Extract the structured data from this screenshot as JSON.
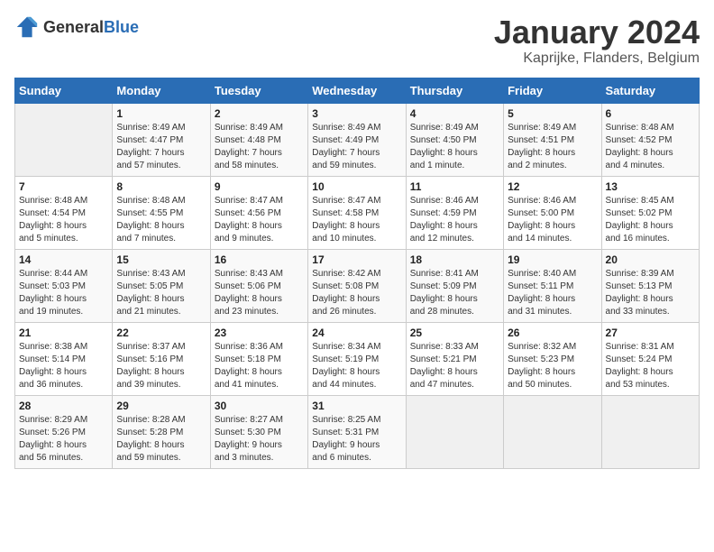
{
  "logo": {
    "general": "General",
    "blue": "Blue"
  },
  "title": "January 2024",
  "location": "Kaprijke, Flanders, Belgium",
  "days_header": [
    "Sunday",
    "Monday",
    "Tuesday",
    "Wednesday",
    "Thursday",
    "Friday",
    "Saturday"
  ],
  "weeks": [
    [
      {
        "day": "",
        "content": ""
      },
      {
        "day": "1",
        "content": "Sunrise: 8:49 AM\nSunset: 4:47 PM\nDaylight: 7 hours\nand 57 minutes."
      },
      {
        "day": "2",
        "content": "Sunrise: 8:49 AM\nSunset: 4:48 PM\nDaylight: 7 hours\nand 58 minutes."
      },
      {
        "day": "3",
        "content": "Sunrise: 8:49 AM\nSunset: 4:49 PM\nDaylight: 7 hours\nand 59 minutes."
      },
      {
        "day": "4",
        "content": "Sunrise: 8:49 AM\nSunset: 4:50 PM\nDaylight: 8 hours\nand 1 minute."
      },
      {
        "day": "5",
        "content": "Sunrise: 8:49 AM\nSunset: 4:51 PM\nDaylight: 8 hours\nand 2 minutes."
      },
      {
        "day": "6",
        "content": "Sunrise: 8:48 AM\nSunset: 4:52 PM\nDaylight: 8 hours\nand 4 minutes."
      }
    ],
    [
      {
        "day": "7",
        "content": "Sunrise: 8:48 AM\nSunset: 4:54 PM\nDaylight: 8 hours\nand 5 minutes."
      },
      {
        "day": "8",
        "content": "Sunrise: 8:48 AM\nSunset: 4:55 PM\nDaylight: 8 hours\nand 7 minutes."
      },
      {
        "day": "9",
        "content": "Sunrise: 8:47 AM\nSunset: 4:56 PM\nDaylight: 8 hours\nand 9 minutes."
      },
      {
        "day": "10",
        "content": "Sunrise: 8:47 AM\nSunset: 4:58 PM\nDaylight: 8 hours\nand 10 minutes."
      },
      {
        "day": "11",
        "content": "Sunrise: 8:46 AM\nSunset: 4:59 PM\nDaylight: 8 hours\nand 12 minutes."
      },
      {
        "day": "12",
        "content": "Sunrise: 8:46 AM\nSunset: 5:00 PM\nDaylight: 8 hours\nand 14 minutes."
      },
      {
        "day": "13",
        "content": "Sunrise: 8:45 AM\nSunset: 5:02 PM\nDaylight: 8 hours\nand 16 minutes."
      }
    ],
    [
      {
        "day": "14",
        "content": "Sunrise: 8:44 AM\nSunset: 5:03 PM\nDaylight: 8 hours\nand 19 minutes."
      },
      {
        "day": "15",
        "content": "Sunrise: 8:43 AM\nSunset: 5:05 PM\nDaylight: 8 hours\nand 21 minutes."
      },
      {
        "day": "16",
        "content": "Sunrise: 8:43 AM\nSunset: 5:06 PM\nDaylight: 8 hours\nand 23 minutes."
      },
      {
        "day": "17",
        "content": "Sunrise: 8:42 AM\nSunset: 5:08 PM\nDaylight: 8 hours\nand 26 minutes."
      },
      {
        "day": "18",
        "content": "Sunrise: 8:41 AM\nSunset: 5:09 PM\nDaylight: 8 hours\nand 28 minutes."
      },
      {
        "day": "19",
        "content": "Sunrise: 8:40 AM\nSunset: 5:11 PM\nDaylight: 8 hours\nand 31 minutes."
      },
      {
        "day": "20",
        "content": "Sunrise: 8:39 AM\nSunset: 5:13 PM\nDaylight: 8 hours\nand 33 minutes."
      }
    ],
    [
      {
        "day": "21",
        "content": "Sunrise: 8:38 AM\nSunset: 5:14 PM\nDaylight: 8 hours\nand 36 minutes."
      },
      {
        "day": "22",
        "content": "Sunrise: 8:37 AM\nSunset: 5:16 PM\nDaylight: 8 hours\nand 39 minutes."
      },
      {
        "day": "23",
        "content": "Sunrise: 8:36 AM\nSunset: 5:18 PM\nDaylight: 8 hours\nand 41 minutes."
      },
      {
        "day": "24",
        "content": "Sunrise: 8:34 AM\nSunset: 5:19 PM\nDaylight: 8 hours\nand 44 minutes."
      },
      {
        "day": "25",
        "content": "Sunrise: 8:33 AM\nSunset: 5:21 PM\nDaylight: 8 hours\nand 47 minutes."
      },
      {
        "day": "26",
        "content": "Sunrise: 8:32 AM\nSunset: 5:23 PM\nDaylight: 8 hours\nand 50 minutes."
      },
      {
        "day": "27",
        "content": "Sunrise: 8:31 AM\nSunset: 5:24 PM\nDaylight: 8 hours\nand 53 minutes."
      }
    ],
    [
      {
        "day": "28",
        "content": "Sunrise: 8:29 AM\nSunset: 5:26 PM\nDaylight: 8 hours\nand 56 minutes."
      },
      {
        "day": "29",
        "content": "Sunrise: 8:28 AM\nSunset: 5:28 PM\nDaylight: 8 hours\nand 59 minutes."
      },
      {
        "day": "30",
        "content": "Sunrise: 8:27 AM\nSunset: 5:30 PM\nDaylight: 9 hours\nand 3 minutes."
      },
      {
        "day": "31",
        "content": "Sunrise: 8:25 AM\nSunset: 5:31 PM\nDaylight: 9 hours\nand 6 minutes."
      },
      {
        "day": "",
        "content": ""
      },
      {
        "day": "",
        "content": ""
      },
      {
        "day": "",
        "content": ""
      }
    ]
  ]
}
